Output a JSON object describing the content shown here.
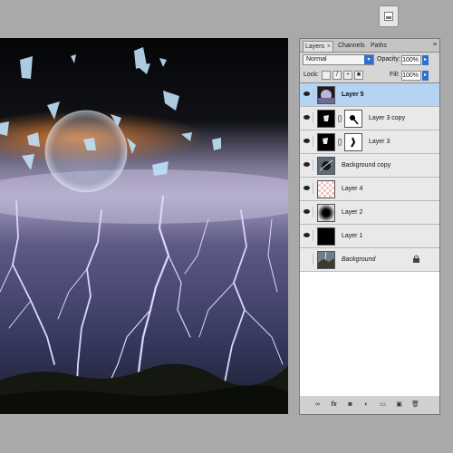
{
  "top_button": {
    "icon": "panel-collapse-icon"
  },
  "layers_panel": {
    "tabs": [
      {
        "label": "Layers",
        "active": true
      },
      {
        "label": "Channels",
        "active": false
      },
      {
        "label": "Paths",
        "active": false
      }
    ],
    "close_glyph": "×",
    "menu_glyph": "≡",
    "blend_mode": "Normal",
    "opacity_label": "Opacity:",
    "opacity_value": "100%",
    "lock_label": "Lock:",
    "fill_label": "Fill:",
    "fill_value": "100%",
    "layers": [
      {
        "name": "Layer 5",
        "visible": true,
        "selected": true,
        "thumb": "layer5"
      },
      {
        "name": "Layer 3 copy",
        "visible": true,
        "selected": false,
        "thumb": "layer3",
        "mask": true
      },
      {
        "name": "Layer 3",
        "visible": true,
        "selected": false,
        "thumb": "layer3",
        "mask": true
      },
      {
        "name": "Background copy",
        "visible": true,
        "selected": false,
        "thumb": "bgcopy"
      },
      {
        "name": "Layer 4",
        "visible": true,
        "selected": false,
        "thumb": "transparent"
      },
      {
        "name": "Layer 2",
        "visible": true,
        "selected": false,
        "thumb": "blob"
      },
      {
        "name": "Layer 1",
        "visible": true,
        "selected": false,
        "thumb": "black"
      },
      {
        "name": "Background",
        "visible": false,
        "selected": false,
        "thumb": "bg",
        "italic": true,
        "locked": true
      }
    ],
    "footer_icons": [
      "link-icon",
      "fx-icon",
      "mask-icon",
      "adjustment-icon",
      "group-icon",
      "new-layer-icon",
      "trash-icon"
    ]
  },
  "colors": {
    "selection": "#b5d3f3",
    "accent": "#2f6fd0",
    "panel": "#d6d6d6"
  }
}
